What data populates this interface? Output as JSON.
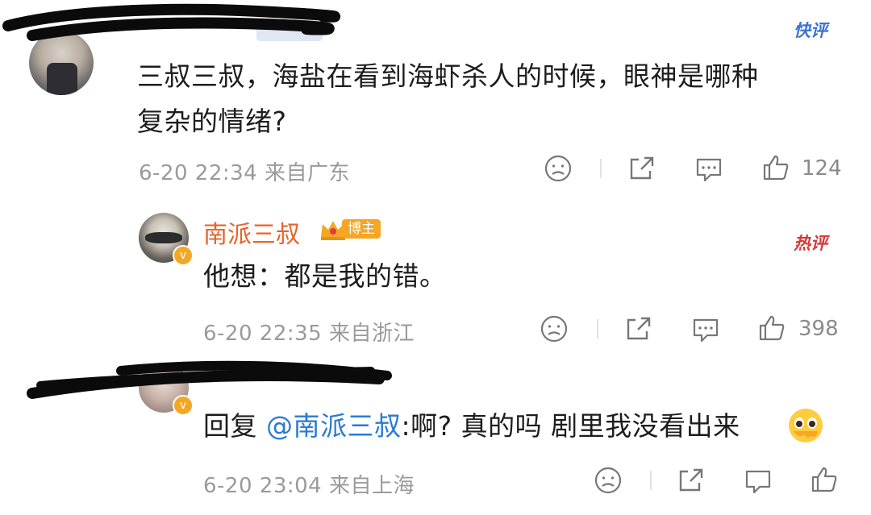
{
  "comment1": {
    "text_line1": "三叔三叔，海盐在看到海虾杀人的时候，眼神是哪种",
    "text_line2": "复杂的情绪?",
    "meta": "6-20 22:34 来自广东",
    "likes": "124",
    "tag": "快评"
  },
  "reply1": {
    "username": "南派三叔",
    "badge": "博主",
    "text": "他想：都是我的错。",
    "meta": "6-20 22:35 来自浙江",
    "likes": "398",
    "tag": "热评"
  },
  "reply2": {
    "prefix": "回复",
    "mention": "@南派三叔",
    "text": ":啊? 真的吗 剧里我没看出来",
    "meta": "6-20 23:04 来自上海"
  },
  "colors": {
    "username": "#e8632a",
    "mention": "#2a7ad4",
    "tag_blue": "#3b74d1",
    "tag_red": "#d23a3a"
  }
}
